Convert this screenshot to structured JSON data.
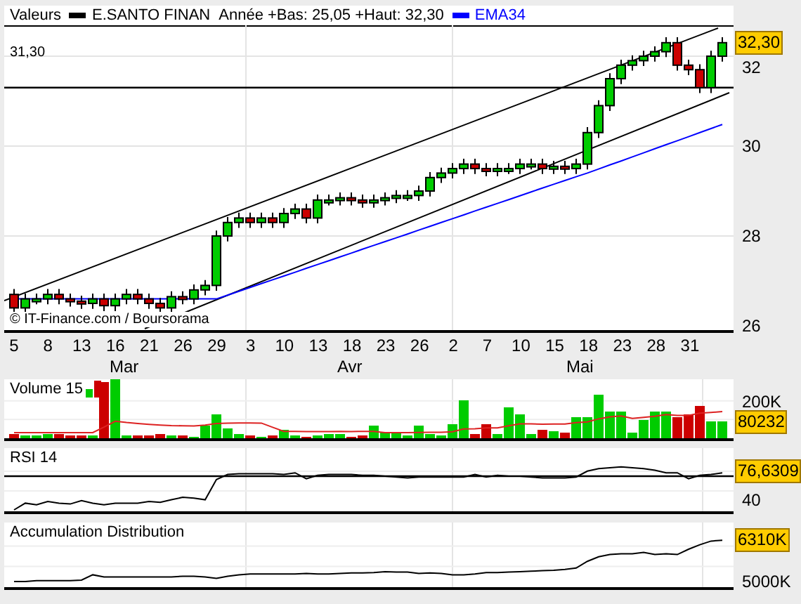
{
  "price_chart": {
    "title": "Valeurs",
    "legend": [
      {
        "label": "E.SANTO FINAN",
        "color": "#000000"
      },
      {
        "label": "EMA34",
        "color": "#0000ff"
      }
    ],
    "range_text": "Année +Bas: 25,05 +Haut: 32,30",
    "reference_label": "31,30",
    "last_price": "32,30",
    "y_axis_labels": [
      "32",
      "30",
      "28",
      "26"
    ],
    "credit": "© IT-Finance.com / Boursorama",
    "x_axis_days": [
      "5",
      "8",
      "13",
      "16",
      "21",
      "26",
      "29",
      "3",
      "10",
      "13",
      "18",
      "23",
      "26",
      "2",
      "7",
      "10",
      "15",
      "18",
      "23",
      "28",
      "31"
    ],
    "months": [
      "Mar",
      "Avr",
      "Mai"
    ]
  },
  "volume_panel": {
    "title": "Volume 15",
    "axis_label": "200K",
    "last_value": "80232"
  },
  "rsi_panel": {
    "title": "RSI 14",
    "last_value": "76,6309",
    "axis_label": "40"
  },
  "accumulation_panel": {
    "title": "Accumulation Distribution",
    "last_value": "6310K",
    "axis_label": "5000K"
  }
}
